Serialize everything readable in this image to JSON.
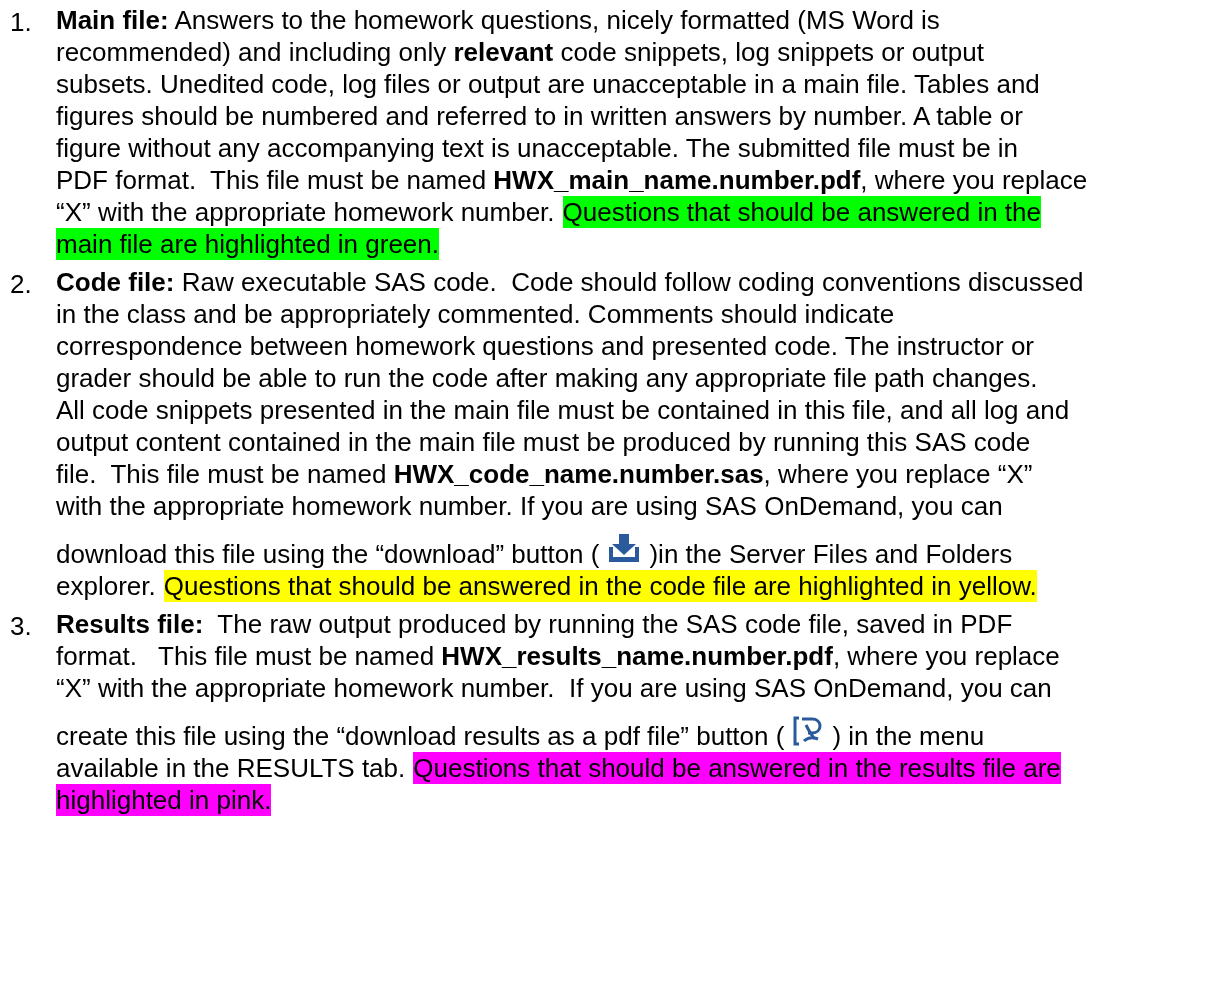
{
  "items": [
    {
      "number": "1.",
      "lines": [
        [
          {
            "kind": "text",
            "text": "**Main file:** Answers to the homework questions, nicely formatted (MS Word is"
          }
        ],
        [
          {
            "kind": "text",
            "text": "recommended) and including only **relevant** code snippets, log snippets or output"
          }
        ],
        [
          {
            "kind": "text",
            "text": "subsets. Unedited code, log files or output are unacceptable in a main file. Tables and"
          }
        ],
        [
          {
            "kind": "text",
            "text": "figures should be numbered and referred to in written answers by number. A table or"
          }
        ],
        [
          {
            "kind": "text",
            "text": "figure without any accompanying text is unacceptable. The submitted file must be in"
          }
        ],
        [
          {
            "kind": "text",
            "text": "PDF format.  This file must be named **HWX_main_name.number.pdf**, where you replace"
          }
        ],
        [
          {
            "kind": "text",
            "text": "“X” with the appropriate homework number."
          },
          {
            "kind": "highlight",
            "text": "Questions that should be answered in the",
            "color": "#00ff00"
          }
        ],
        [
          {
            "kind": "highlight",
            "text": "main file are highlighted in green.",
            "color": "#00ff00"
          }
        ]
      ]
    },
    {
      "number": "2.",
      "lines": [
        [
          {
            "kind": "text",
            "text": "**Code file:** Raw executable SAS code.  Code should follow coding conventions discussed"
          }
        ],
        [
          {
            "kind": "text",
            "text": "in the class and be appropriately commented. Comments should indicate"
          }
        ],
        [
          {
            "kind": "text",
            "text": "correspondence between homework questions and presented code. The instructor or"
          }
        ],
        [
          {
            "kind": "text",
            "text": "grader should be able to run the code after making any appropriate file path changes."
          }
        ],
        [
          {
            "kind": "text",
            "text": "All code snippets presented in the main file must be contained in this file, and all log and"
          }
        ],
        [
          {
            "kind": "text",
            "text": "output content contained in the main file must be produced by running this SAS code"
          }
        ],
        [
          {
            "kind": "text",
            "text": "file.  This file must be named **HWX_code_name.number.sas**, where you replace “X”"
          }
        ],
        [
          {
            "kind": "text",
            "text": "with the appropriate homework number. If you are using SAS OnDemand, you can"
          }
        ],
        [
          {
            "kind": "text",
            "text": "download this file using the “download” button ("
          },
          {
            "kind": "download-icon"
          },
          {
            "kind": "text",
            "text": ")in the Server Files and Folders"
          }
        ],
        [
          {
            "kind": "text",
            "text": "explorer."
          },
          {
            "kind": "highlight",
            "text": "Questions that should be answered in the code file are highlighted in yellow.",
            "color": "#ffff00"
          }
        ]
      ]
    },
    {
      "number": "3.",
      "lines": [
        [
          {
            "kind": "text",
            "text": "**Results file:**  The raw output produced by running the SAS code file, saved in PDF"
          }
        ],
        [
          {
            "kind": "text",
            "text": "format.   This file must be named **HWX_results_name.number.pdf**, where you replace"
          }
        ],
        [
          {
            "kind": "text",
            "text": "“X” with the appropriate homework number.  If you are using SAS OnDemand, you can"
          }
        ],
        [
          {
            "kind": "text",
            "text": "create this file using the “download results as a pdf file” button ("
          },
          {
            "kind": "export-icon"
          },
          {
            "kind": "text",
            "text": ") in the menu"
          }
        ],
        [
          {
            "kind": "text",
            "text": "available in the RESULTS tab."
          },
          {
            "kind": "highlight",
            "text": "Questions that should be answered in the results file are",
            "color": "#ff00ff"
          }
        ],
        [
          {
            "kind": "highlight",
            "text": "highlighted in pink.",
            "color": "#ff00ff"
          }
        ]
      ]
    }
  ]
}
